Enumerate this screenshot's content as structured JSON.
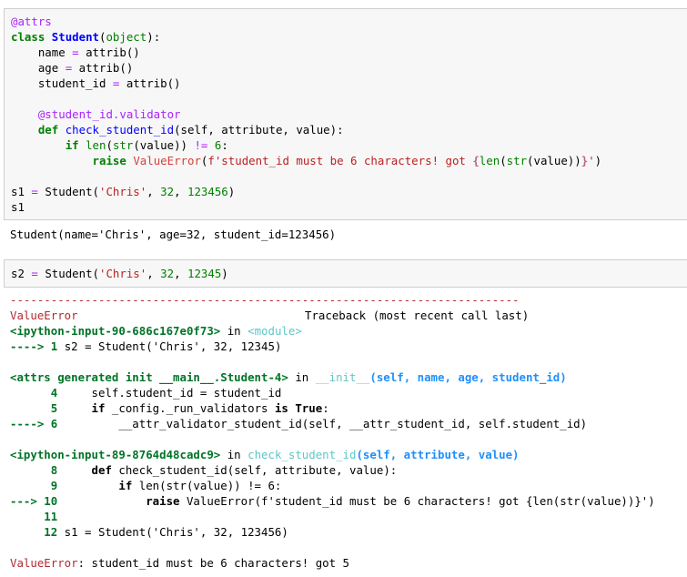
{
  "cell1": {
    "lines": [
      "@attrs",
      "class Student(object):",
      "    name = attrib()",
      "    age = attrib()",
      "    student_id = attrib()",
      "",
      "    @student_id.validator",
      "    def check_student_id(self, attribute, value):",
      "        if len(str(value)) != 6:",
      "            raise ValueError(f'student_id must be 6 characters! got {len(str(value))}')",
      "",
      "s1 = Student('Chris', 32, 123456)",
      "s1"
    ]
  },
  "output1": "Student(name='Chris', age=32, student_id=123456)",
  "cell2": {
    "line": "s2 = Student('Chris', 32, 12345)"
  },
  "traceback": {
    "dashes": "---------------------------------------------------------------------------",
    "error_name": "ValueError",
    "header_right": "Traceback (most recent call last)",
    "frame1_file": "<ipython-input-90-686c167e0f73>",
    "frame1_in": " in ",
    "frame1_module": "<module>",
    "frame1_arrow": "----> 1 ",
    "frame1_code": "s2 = Student('Chris', 32, 12345)",
    "frame2_file": "<attrs generated init __main__.Student-4>",
    "frame2_in": " in ",
    "frame2_func": "__init__",
    "frame2_args": "(self, name, age, student_id)",
    "frame2_l4": "      4     self.student_id = student_id",
    "frame2_l5": "      5     if _config._run_validators is True:",
    "frame2_l6_arrow": "----> 6 ",
    "frame2_l6_code": "        __attr_validator_student_id(self, __attr_student_id, self.student_id)",
    "frame3_file": "<ipython-input-89-8764d48cadc9>",
    "frame3_in": " in ",
    "frame3_func": "check_student_id",
    "frame3_args": "(self, attribute, value)",
    "frame3_l8": "      8     def check_student_id(self, attribute, value):",
    "frame3_l9": "      9         if len(str(value)) != 6:",
    "frame3_l10_arrow": "---> 10 ",
    "frame3_l10_code": "            raise ValueError(f'student_id must be 6 characters! got {len(str(value))}')",
    "frame3_l11": "     11",
    "frame3_l12": "     12 s1 = Student('Chris', 32, 123456)",
    "final_error": "ValueError",
    "final_msg": ": student_id must be 6 characters! got 5"
  },
  "colors": {
    "cell_bg": "#f7f7f7",
    "cell_border": "#cfcfcf",
    "traceback_red": "#b22b31",
    "traceback_green": "#007427",
    "traceback_cyan": "#60c6c8",
    "traceback_blue": "#208ffb"
  }
}
